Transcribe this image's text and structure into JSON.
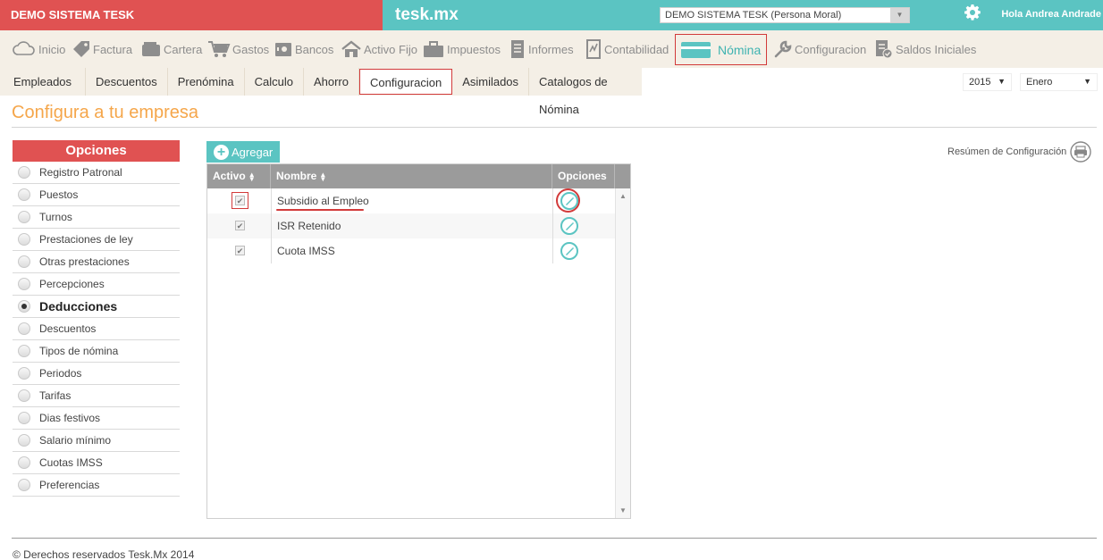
{
  "header": {
    "account_name": "DEMO SISTEMA TESK",
    "brand": "tesk.mx",
    "company_select_value": "DEMO SISTEMA TESK (Persona Moral)",
    "greeting": "Hola Andrea Andrade",
    "settings_icon": "gear-icon"
  },
  "main_nav": {
    "items": [
      {
        "label": "Inicio",
        "icon": "cloud-icon"
      },
      {
        "label": "Factura",
        "icon": "tag-icon"
      },
      {
        "label": "Cartera",
        "icon": "wallet-icon"
      },
      {
        "label": "Gastos",
        "icon": "cart-icon"
      },
      {
        "label": "Bancos",
        "icon": "safe-icon"
      },
      {
        "label": "Activo Fijo",
        "icon": "house-icon"
      },
      {
        "label": "Impuestos",
        "icon": "briefcase-icon"
      },
      {
        "label": "Informes",
        "icon": "document-icon"
      },
      {
        "label": "Contabilidad",
        "icon": "ledger-icon"
      },
      {
        "label": "Nómina",
        "icon": "card-icon",
        "active": true
      },
      {
        "label": "Configuracion",
        "icon": "wrench-icon"
      },
      {
        "label": "Saldos Iniciales",
        "icon": "balance-doc-icon"
      }
    ]
  },
  "sub_nav": {
    "tabs": [
      {
        "label": "Empleados"
      },
      {
        "label": "Descuentos"
      },
      {
        "label": "Prenómina"
      },
      {
        "label": "Calculo"
      },
      {
        "label": "Ahorro"
      },
      {
        "label": "Configuracion",
        "active": true
      },
      {
        "label": "Asimilados"
      },
      {
        "label": "Catalogos de Nómina"
      }
    ],
    "year_select": "2015",
    "month_select": "Enero"
  },
  "page": {
    "title": "Configura a tu empresa"
  },
  "sidebar": {
    "header": "Opciones",
    "items": [
      {
        "label": "Registro Patronal"
      },
      {
        "label": "Puestos"
      },
      {
        "label": "Turnos"
      },
      {
        "label": "Prestaciones de ley"
      },
      {
        "label": "Otras prestaciones"
      },
      {
        "label": "Percepciones"
      },
      {
        "label": "Deducciones",
        "selected": true
      },
      {
        "label": "Descuentos"
      },
      {
        "label": "Tipos de nómina"
      },
      {
        "label": "Periodos"
      },
      {
        "label": "Tarifas"
      },
      {
        "label": "Dias festivos"
      },
      {
        "label": "Salario mínimo"
      },
      {
        "label": "Cuotas IMSS"
      },
      {
        "label": "Preferencias"
      }
    ]
  },
  "toolbar": {
    "add_label": "Agregar",
    "summary_label": "Resúmen de Configuración",
    "print_icon": "printer-icon"
  },
  "table": {
    "columns": [
      "Activo",
      "Nombre",
      "Opciones"
    ],
    "rows": [
      {
        "active": true,
        "name": "Subsidio al Empleo"
      },
      {
        "active": true,
        "name": "ISR Retenido"
      },
      {
        "active": true,
        "name": "Cuota IMSS"
      }
    ]
  },
  "footer": {
    "copyright": "© Derechos reservados Tesk.Mx 2014"
  },
  "colors": {
    "brand_red": "#e05252",
    "brand_teal": "#5bc4c2",
    "title_orange": "#f5a64a",
    "nav_bg": "#f4efe6"
  }
}
